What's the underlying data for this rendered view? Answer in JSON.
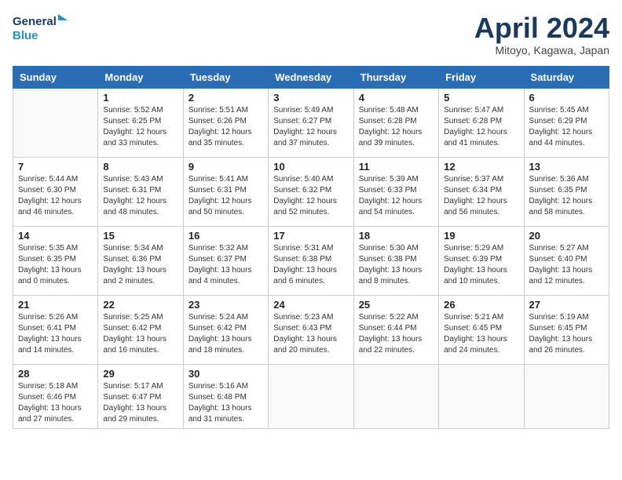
{
  "header": {
    "logo_line1": "General",
    "logo_line2": "Blue",
    "title": "April 2024",
    "subtitle": "Mitoyo, Kagawa, Japan"
  },
  "days_of_week": [
    "Sunday",
    "Monday",
    "Tuesday",
    "Wednesday",
    "Thursday",
    "Friday",
    "Saturday"
  ],
  "weeks": [
    [
      {
        "day": "",
        "info": ""
      },
      {
        "day": "1",
        "info": "Sunrise: 5:52 AM\nSunset: 6:25 PM\nDaylight: 12 hours\nand 33 minutes."
      },
      {
        "day": "2",
        "info": "Sunrise: 5:51 AM\nSunset: 6:26 PM\nDaylight: 12 hours\nand 35 minutes."
      },
      {
        "day": "3",
        "info": "Sunrise: 5:49 AM\nSunset: 6:27 PM\nDaylight: 12 hours\nand 37 minutes."
      },
      {
        "day": "4",
        "info": "Sunrise: 5:48 AM\nSunset: 6:28 PM\nDaylight: 12 hours\nand 39 minutes."
      },
      {
        "day": "5",
        "info": "Sunrise: 5:47 AM\nSunset: 6:28 PM\nDaylight: 12 hours\nand 41 minutes."
      },
      {
        "day": "6",
        "info": "Sunrise: 5:45 AM\nSunset: 6:29 PM\nDaylight: 12 hours\nand 44 minutes."
      }
    ],
    [
      {
        "day": "7",
        "info": "Sunrise: 5:44 AM\nSunset: 6:30 PM\nDaylight: 12 hours\nand 46 minutes."
      },
      {
        "day": "8",
        "info": "Sunrise: 5:43 AM\nSunset: 6:31 PM\nDaylight: 12 hours\nand 48 minutes."
      },
      {
        "day": "9",
        "info": "Sunrise: 5:41 AM\nSunset: 6:31 PM\nDaylight: 12 hours\nand 50 minutes."
      },
      {
        "day": "10",
        "info": "Sunrise: 5:40 AM\nSunset: 6:32 PM\nDaylight: 12 hours\nand 52 minutes."
      },
      {
        "day": "11",
        "info": "Sunrise: 5:39 AM\nSunset: 6:33 PM\nDaylight: 12 hours\nand 54 minutes."
      },
      {
        "day": "12",
        "info": "Sunrise: 5:37 AM\nSunset: 6:34 PM\nDaylight: 12 hours\nand 56 minutes."
      },
      {
        "day": "13",
        "info": "Sunrise: 5:36 AM\nSunset: 6:35 PM\nDaylight: 12 hours\nand 58 minutes."
      }
    ],
    [
      {
        "day": "14",
        "info": "Sunrise: 5:35 AM\nSunset: 6:35 PM\nDaylight: 13 hours\nand 0 minutes."
      },
      {
        "day": "15",
        "info": "Sunrise: 5:34 AM\nSunset: 6:36 PM\nDaylight: 13 hours\nand 2 minutes."
      },
      {
        "day": "16",
        "info": "Sunrise: 5:32 AM\nSunset: 6:37 PM\nDaylight: 13 hours\nand 4 minutes."
      },
      {
        "day": "17",
        "info": "Sunrise: 5:31 AM\nSunset: 6:38 PM\nDaylight: 13 hours\nand 6 minutes."
      },
      {
        "day": "18",
        "info": "Sunrise: 5:30 AM\nSunset: 6:38 PM\nDaylight: 13 hours\nand 8 minutes."
      },
      {
        "day": "19",
        "info": "Sunrise: 5:29 AM\nSunset: 6:39 PM\nDaylight: 13 hours\nand 10 minutes."
      },
      {
        "day": "20",
        "info": "Sunrise: 5:27 AM\nSunset: 6:40 PM\nDaylight: 13 hours\nand 12 minutes."
      }
    ],
    [
      {
        "day": "21",
        "info": "Sunrise: 5:26 AM\nSunset: 6:41 PM\nDaylight: 13 hours\nand 14 minutes."
      },
      {
        "day": "22",
        "info": "Sunrise: 5:25 AM\nSunset: 6:42 PM\nDaylight: 13 hours\nand 16 minutes."
      },
      {
        "day": "23",
        "info": "Sunrise: 5:24 AM\nSunset: 6:42 PM\nDaylight: 13 hours\nand 18 minutes."
      },
      {
        "day": "24",
        "info": "Sunrise: 5:23 AM\nSunset: 6:43 PM\nDaylight: 13 hours\nand 20 minutes."
      },
      {
        "day": "25",
        "info": "Sunrise: 5:22 AM\nSunset: 6:44 PM\nDaylight: 13 hours\nand 22 minutes."
      },
      {
        "day": "26",
        "info": "Sunrise: 5:21 AM\nSunset: 6:45 PM\nDaylight: 13 hours\nand 24 minutes."
      },
      {
        "day": "27",
        "info": "Sunrise: 5:19 AM\nSunset: 6:45 PM\nDaylight: 13 hours\nand 26 minutes."
      }
    ],
    [
      {
        "day": "28",
        "info": "Sunrise: 5:18 AM\nSunset: 6:46 PM\nDaylight: 13 hours\nand 27 minutes."
      },
      {
        "day": "29",
        "info": "Sunrise: 5:17 AM\nSunset: 6:47 PM\nDaylight: 13 hours\nand 29 minutes."
      },
      {
        "day": "30",
        "info": "Sunrise: 5:16 AM\nSunset: 6:48 PM\nDaylight: 13 hours\nand 31 minutes."
      },
      {
        "day": "",
        "info": ""
      },
      {
        "day": "",
        "info": ""
      },
      {
        "day": "",
        "info": ""
      },
      {
        "day": "",
        "info": ""
      }
    ]
  ]
}
